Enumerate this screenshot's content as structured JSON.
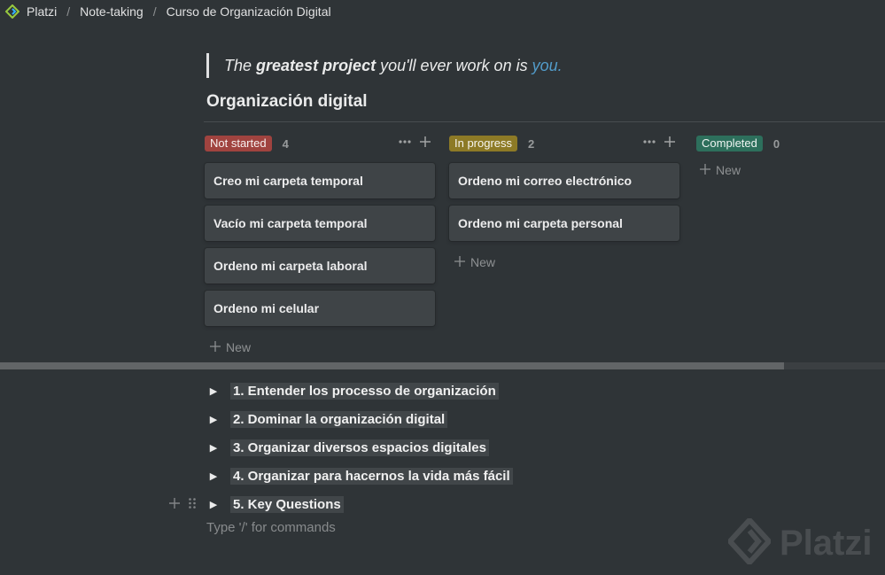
{
  "breadcrumb": {
    "items": [
      "Platzi",
      "Note-taking",
      "Curso de Organización Digital"
    ],
    "separator": "/"
  },
  "quote": {
    "part1": "The ",
    "bold": "greatest project",
    "part2": " you'll ever work on is ",
    "accent": "you."
  },
  "database_title": "Organización digital",
  "board": {
    "columns": [
      {
        "status": "Not started",
        "count": "4",
        "color": "#a0433f",
        "cards": [
          "Creo mi carpeta temporal",
          "Vacío mi carpeta temporal",
          "Ordeno mi carpeta laboral",
          "Ordeno mi celular"
        ],
        "new_label": "New"
      },
      {
        "status": "In progress",
        "count": "2",
        "color": "#8d7a26",
        "cards": [
          "Ordeno mi correo electrónico",
          "Ordeno mi carpeta personal"
        ],
        "new_label": "New"
      },
      {
        "status": "Completed",
        "count": "0",
        "color": "#2d6f5c",
        "cards": [],
        "new_label": "New"
      }
    ]
  },
  "toggles": [
    "1. Entender los processo de organización",
    "2. Dominar la organización digital",
    "3. Organizar diversos espacios digitales",
    "4. Organizar para hacernos la vida más fácil",
    "5. Key Questions"
  ],
  "placeholder": "Type '/' for commands",
  "watermark": "Platzi",
  "icons": {
    "logo": "platzi-logo-icon",
    "more": "more-horizontal-icon",
    "add": "plus-icon",
    "toggle": "triangle-right-icon",
    "drag": "drag-handle-icon"
  },
  "colors": {
    "background": "#2f3437",
    "card": "#3f4447",
    "accent": "#529cca"
  }
}
